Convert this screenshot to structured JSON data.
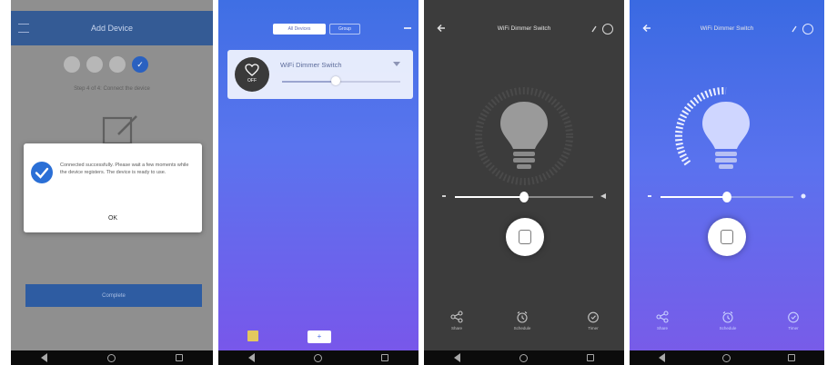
{
  "phone1": {
    "status_left": "",
    "status_right": "",
    "appbar_title": "Add Device",
    "step_icons": [
      "step-dot",
      "step-dot",
      "step-dot",
      "check-icon"
    ],
    "steps_caption": "Step 4 of 4: Connect the device",
    "dialog_message": "Connected successfully. Please wait a few moments while the device registers. The device is ready to use.",
    "dialog_ok": "OK",
    "confirm_label": "Complete"
  },
  "phone2": {
    "tab_active": "All Devices",
    "tab_other": "Group",
    "device_title": "WiFi Dimmer Switch",
    "power_label": "OFF",
    "add_label": "+"
  },
  "phone3": {
    "title": "WiFi Dimmer Switch",
    "actions": [
      {
        "icon": "share-icon",
        "label": "Share"
      },
      {
        "icon": "alarm-icon",
        "label": "Schedule"
      },
      {
        "icon": "timer-icon",
        "label": "Timer"
      }
    ]
  },
  "phone4": {
    "title": "WiFi Dimmer Switch",
    "actions": [
      {
        "icon": "share-icon",
        "label": "Share"
      },
      {
        "icon": "alarm-icon",
        "label": "Schedule"
      },
      {
        "icon": "timer-icon",
        "label": "Timer"
      }
    ]
  },
  "brightness": {
    "phone2": 0.45,
    "phone3": 0.5,
    "phone4": 0.5
  },
  "colors": {
    "appbar_blue": "#345b95",
    "accent_blue": "#2a6fd6",
    "dark_bg": "#3c3c3c",
    "purple_end": "#7a55ea"
  }
}
